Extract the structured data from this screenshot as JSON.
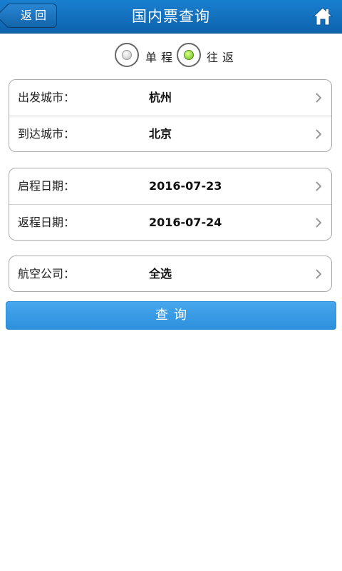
{
  "header": {
    "back_label": "返回",
    "title": "国内票查询",
    "home_icon": "home-icon"
  },
  "trip_type": {
    "options": [
      {
        "label": "单程",
        "selected": false
      },
      {
        "label": "往返",
        "selected": true
      }
    ]
  },
  "route": {
    "departure_label": "出发城市：",
    "departure_value": "杭州",
    "arrival_label": "到达城市：",
    "arrival_value": "北京"
  },
  "dates": {
    "depart_label": "启程日期：",
    "depart_value": "2016-07-23",
    "return_label": "返程日期：",
    "return_value": "2016-07-24"
  },
  "airline": {
    "label": "航空公司：",
    "value": "全选"
  },
  "query_button": "查询",
  "colors": {
    "header": "#1a72c2",
    "button": "#3a9be6",
    "radio_selected": "#7ccc22"
  }
}
